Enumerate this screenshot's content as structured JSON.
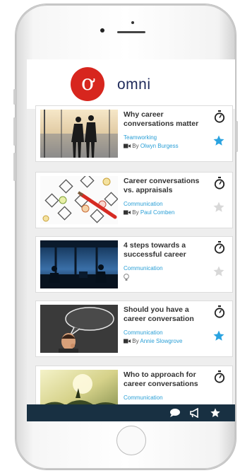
{
  "app": {
    "brand": "omni",
    "logo_glyph": "ơ",
    "accent_color": "#d7261e",
    "link_color": "#2a9fd6",
    "nav_color": "#183042"
  },
  "cards": [
    {
      "title": "Why career conversations matter",
      "category": "Teamworking",
      "by": "By",
      "author": "Olwyn Burgess",
      "type_icon": "video-icon",
      "starred": true
    },
    {
      "title": "Career conversations vs. appraisals",
      "category": "Communication",
      "by": "By",
      "author": "Paul Comben",
      "type_icon": "video-icon",
      "starred": false
    },
    {
      "title": "4 steps towards a successful career",
      "category": "Communication",
      "by": "",
      "author": "",
      "type_icon": "lightbulb-icon",
      "starred": false
    },
    {
      "title": "Should you have a career conversation",
      "category": "Communication",
      "by": "By",
      "author": "Annie Slowgrove",
      "type_icon": "video-icon",
      "starred": true
    },
    {
      "title": "Who to approach for career conversations",
      "category": "Communication",
      "by": "",
      "author": "",
      "type_icon": "",
      "starred": false
    }
  ],
  "bottom_nav": [
    {
      "icon": "chat-icon"
    },
    {
      "icon": "megaphone-icon"
    },
    {
      "icon": "star-icon"
    }
  ]
}
